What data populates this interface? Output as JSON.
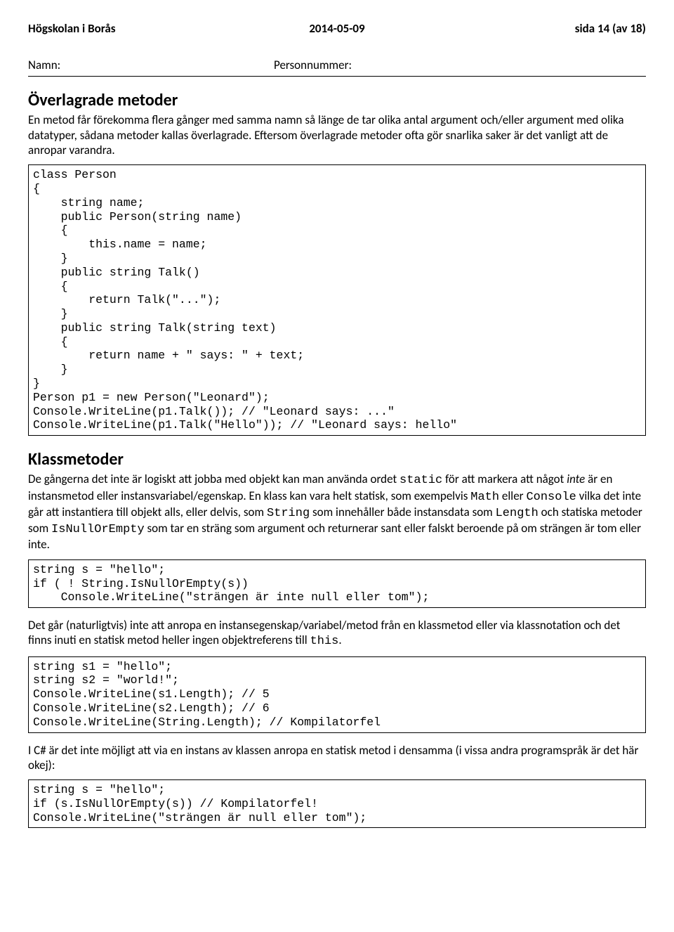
{
  "header": {
    "left": "Högskolan i Borås",
    "center": "2014-05-09",
    "right": "sida 14 (av 18)"
  },
  "labels": {
    "name": "Namn:",
    "person": "Personnummer:"
  },
  "section1": {
    "title": "Överlagrade metoder",
    "body": "En metod får förekomma flera gånger med samma namn så länge de tar olika antal argument och/eller argument med olika datatyper, sådana metoder kallas överlagrade. Eftersom överlagrade metoder ofta gör snarlika saker är det vanligt att de anropar varandra."
  },
  "code1": "class Person\n{\n    string name;\n    public Person(string name)\n    {\n        this.name = name;\n    }\n    public string Talk()\n    {\n        return Talk(\"...\");\n    }\n    public string Talk(string text)\n    {\n        return name + \" says: \" + text;\n    }\n}\nPerson p1 = new Person(\"Leonard\");\nConsole.WriteLine(p1.Talk()); // \"Leonard says: ...\"\nConsole.WriteLine(p1.Talk(\"Hello\")); // \"Leonard says: hello\"",
  "section2": {
    "title": "Klassmetoder",
    "para1_parts": {
      "t1": "De gångerna det inte är logiskt att jobba med objekt kan man använda ordet ",
      "c1": "static",
      "t2": " för att markera att något ",
      "i1": "inte",
      "t3": " är en instansmetod eller instansvariabel/egenskap. En klass kan vara helt statisk, som exempelvis ",
      "c2": "Math",
      "t4": " eller ",
      "c3": "Console",
      "t5": " vilka det inte går att instantiera till objekt alls, eller delvis, som ",
      "c4": "String",
      "t6": " som innehåller både instansdata som ",
      "c5": "Length",
      "t7": " och statiska metoder som ",
      "c6": "IsNullOrEmpty",
      "t8": " som tar en sträng som argument och returnerar sant eller falskt beroende på om strängen är tom eller inte."
    }
  },
  "code2": "string s = \"hello\";\nif ( ! String.IsNullOrEmpty(s))\n    Console.WriteLine(\"strängen är inte null eller tom\");",
  "para2_parts": {
    "t1": "Det går (naturligtvis) inte att anropa en instansegenskap/variabel/metod från en klassmetod eller via klassnotation och det finns inuti en statisk metod heller ingen objektreferens till ",
    "c1": "this",
    "t2": "."
  },
  "code3": "string s1 = \"hello\";\nstring s2 = \"world!\";\nConsole.WriteLine(s1.Length); // 5\nConsole.WriteLine(s2.Length); // 6\nConsole.WriteLine(String.Length); // Kompilatorfel",
  "para3": "I C# är det inte möjligt att via en instans av klassen anropa en statisk metod i densamma (i vissa andra programspråk är det här okej):",
  "code4": "string s = \"hello\";\nif (s.IsNullOrEmpty(s)) // Kompilatorfel!\nConsole.WriteLine(\"strängen är null eller tom\");"
}
